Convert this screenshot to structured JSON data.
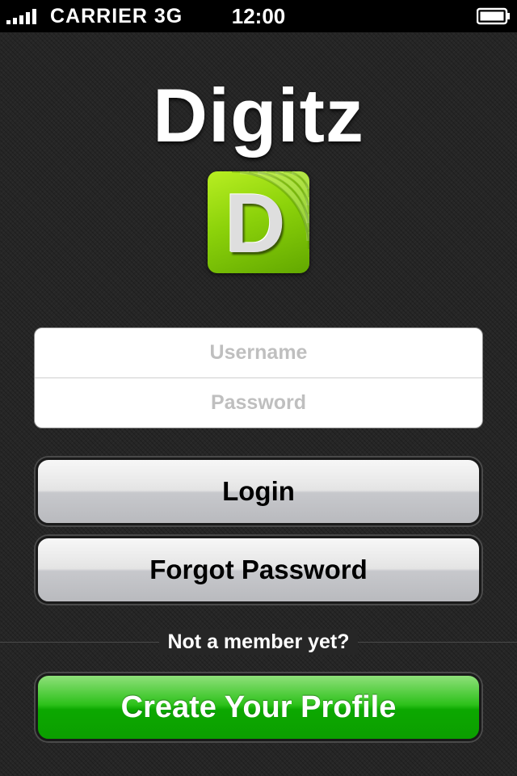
{
  "status_bar": {
    "carrier": "CARRIER",
    "network": "3G",
    "time": "12:00",
    "signal_icon": "signal-bars-icon",
    "battery_icon": "battery-icon"
  },
  "app": {
    "title": "Digitz",
    "logo_letter": "D",
    "logo_icon": "digitz-logo-icon"
  },
  "form": {
    "username": {
      "placeholder": "Username",
      "value": ""
    },
    "password": {
      "placeholder": "Password",
      "value": ""
    }
  },
  "buttons": {
    "login": "Login",
    "forgot_password": "Forgot Password",
    "create_profile": "Create Your Profile"
  },
  "signup": {
    "prompt": "Not a member yet?"
  },
  "colors": {
    "logo_green": "#8cd20a",
    "create_button_green": "#0ca800",
    "background": "#262626"
  }
}
